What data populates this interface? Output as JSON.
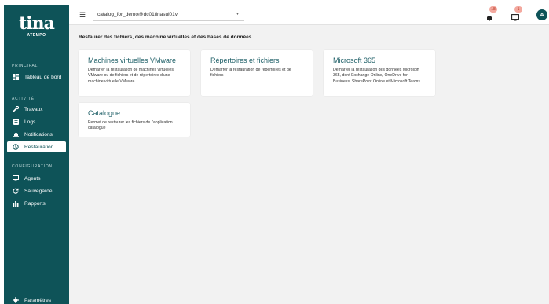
{
  "logo": {
    "main": "tina",
    "sub": "ATEMPO"
  },
  "sidebar": {
    "sections": {
      "principal": "PRINCIPAL",
      "activite": "ACTIVITÉ",
      "configuration": "CONFIGURATION"
    },
    "items": [
      {
        "label": "Tableau de bord",
        "icon": "dashboard-icon"
      },
      {
        "label": "Travaux",
        "icon": "wrench-icon"
      },
      {
        "label": "Logs",
        "icon": "logs-icon"
      },
      {
        "label": "Notifications",
        "icon": "bell-icon"
      },
      {
        "label": "Restauration",
        "icon": "history-icon",
        "active": true
      },
      {
        "label": "Agents",
        "icon": "monitor-icon"
      },
      {
        "label": "Sauvegarde",
        "icon": "backup-icon"
      },
      {
        "label": "Rapports",
        "icon": "bar-chart-icon"
      },
      {
        "label": "Paramètres",
        "icon": "gear-icon"
      }
    ]
  },
  "topbar": {
    "catalog_value": "catalog_for_demo@dc01tinasui01v",
    "notifications_count": "18",
    "messages_count": "1",
    "avatar_initial": "A"
  },
  "main": {
    "title": "Restaurer des fichiers, des machine virtuelles et des bases de données",
    "cards": [
      {
        "title": "Machines virtuelles VMware",
        "desc": "Démarrer la restauration de machines virtuelles VMware ou de fichiers et de répertoires d'une machine virtuelle VMware"
      },
      {
        "title": "Répertoires et fichiers",
        "desc": "Démarrer la restauration de répertoires et de fichiers"
      },
      {
        "title": "Microsoft 365",
        "desc": "Démarrer la restauration des données Microsoft 365, dont Exchange Online, OneDrive for Business, SharePoint Online et Microsoft Teams"
      },
      {
        "title": "Catalogue",
        "desc": "Permet de restaurer les fichiers de l'application catalogue"
      }
    ]
  },
  "colors": {
    "sidebar": "#0e5358",
    "accent": "#1e5f67",
    "badge": "#f3a89e",
    "background": "#f2f2f2"
  }
}
